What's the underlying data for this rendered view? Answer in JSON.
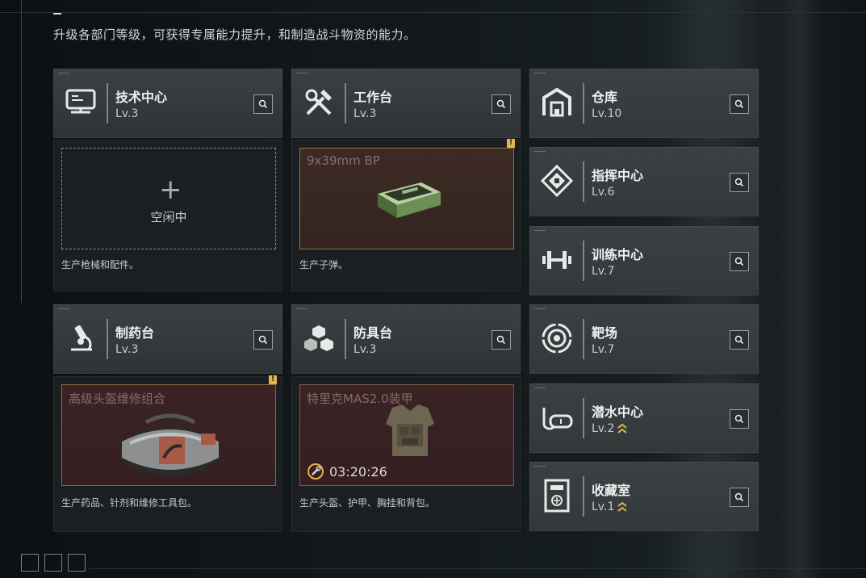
{
  "intro": "升级各部门等级，可获得专属能力提升，和制造战斗物资的能力。",
  "stations": {
    "tech": {
      "name": "技术中心",
      "level": "Lv.3",
      "desc": "生产枪械和配件。",
      "status": "空闲中",
      "icon": "computer-icon"
    },
    "workbench": {
      "name": "工作台",
      "level": "Lv.3",
      "desc": "生产子弹。",
      "item": "9x39mm BP",
      "icon": "tools-icon"
    },
    "pharmacy": {
      "name": "制药台",
      "level": "Lv.3",
      "desc": "生产药品、针剂和维修工具包。",
      "item": "高级头盔维修组合",
      "icon": "microscope-icon"
    },
    "armor": {
      "name": "防具台",
      "level": "Lv.3",
      "desc": "生产头盔、护甲、胸挂和背包。",
      "item": "特里克MAS2.0装甲",
      "timer": "03:20:26",
      "icon": "cubes-icon"
    },
    "warehouse": {
      "name": "仓库",
      "level": "Lv.10",
      "icon": "warehouse-icon"
    },
    "command": {
      "name": "指挥中心",
      "level": "Lv.6",
      "icon": "command-icon"
    },
    "training": {
      "name": "训练中心",
      "level": "Lv.7",
      "icon": "dumbbell-icon"
    },
    "range": {
      "name": "靶场",
      "level": "Lv.7",
      "icon": "target-icon"
    },
    "diving": {
      "name": "潜水中心",
      "level": "Lv.2",
      "icon": "diving-mask-icon"
    },
    "collection": {
      "name": "收藏室",
      "level": "Lv.1",
      "icon": "collection-icon"
    }
  },
  "colors": {
    "accent": "#e0b84a",
    "panel": "#33383b",
    "production_bg": "#3b2324"
  }
}
